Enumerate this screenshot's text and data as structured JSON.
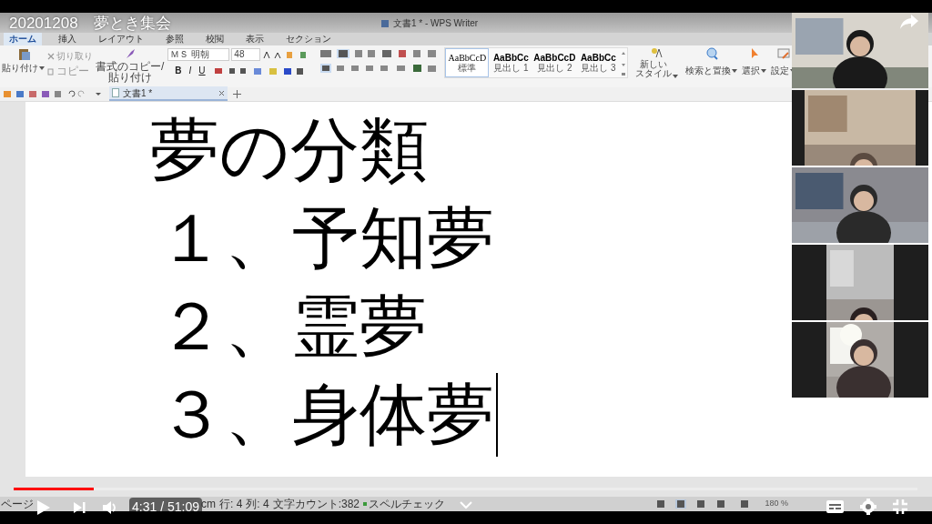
{
  "video_title": "20201208　夢とき集会",
  "app": {
    "title": "文書1 * - WPS Writer",
    "menu_tabs": [
      {
        "label": "ホーム",
        "selected": true
      },
      {
        "label": "挿入",
        "selected": false
      },
      {
        "label": "レイアウト",
        "selected": false
      },
      {
        "label": "参照",
        "selected": false
      },
      {
        "label": "校閲",
        "selected": false
      },
      {
        "label": "表示",
        "selected": false
      },
      {
        "label": "セクション",
        "selected": false
      }
    ],
    "clipboard": {
      "paste": "貼り付け",
      "cut": "切り取り",
      "copy": "コピー",
      "format_painter": [
        "書式のコピー/",
        "貼り付け"
      ]
    },
    "font_name": "ＭＳ 明朝",
    "font_size": "48",
    "format_buttons": [
      "B",
      "I",
      "U"
    ],
    "styles": [
      {
        "preview": "AaBbCcD",
        "label": "標準",
        "selected": true
      },
      {
        "preview": "AaBbCc",
        "label": "見出し 1",
        "selected": false
      },
      {
        "preview": "AaBbCcD",
        "label": "見出し 2",
        "selected": false
      },
      {
        "preview": "AaBbCc",
        "label": "見出し 3",
        "selected": false
      }
    ],
    "new_style": [
      "新しい",
      "スタイル"
    ],
    "tools": [
      "検索と置換",
      "選択",
      "設定"
    ],
    "doc_tabs": [
      {
        "label": "文書1 *",
        "selected": true
      }
    ],
    "document": {
      "heading": "夢の分類",
      "lines": [
        "１、予知夢",
        "２、霊夢",
        "３、身体夢"
      ]
    },
    "status_bar": [
      "ページ",
      "cm",
      "行: 4",
      "列: 4",
      "文字カウント:382",
      "スペルチェック"
    ],
    "zoom": "180 %"
  },
  "player": {
    "time": "4:31 / 51:09",
    "level": 0.089
  }
}
